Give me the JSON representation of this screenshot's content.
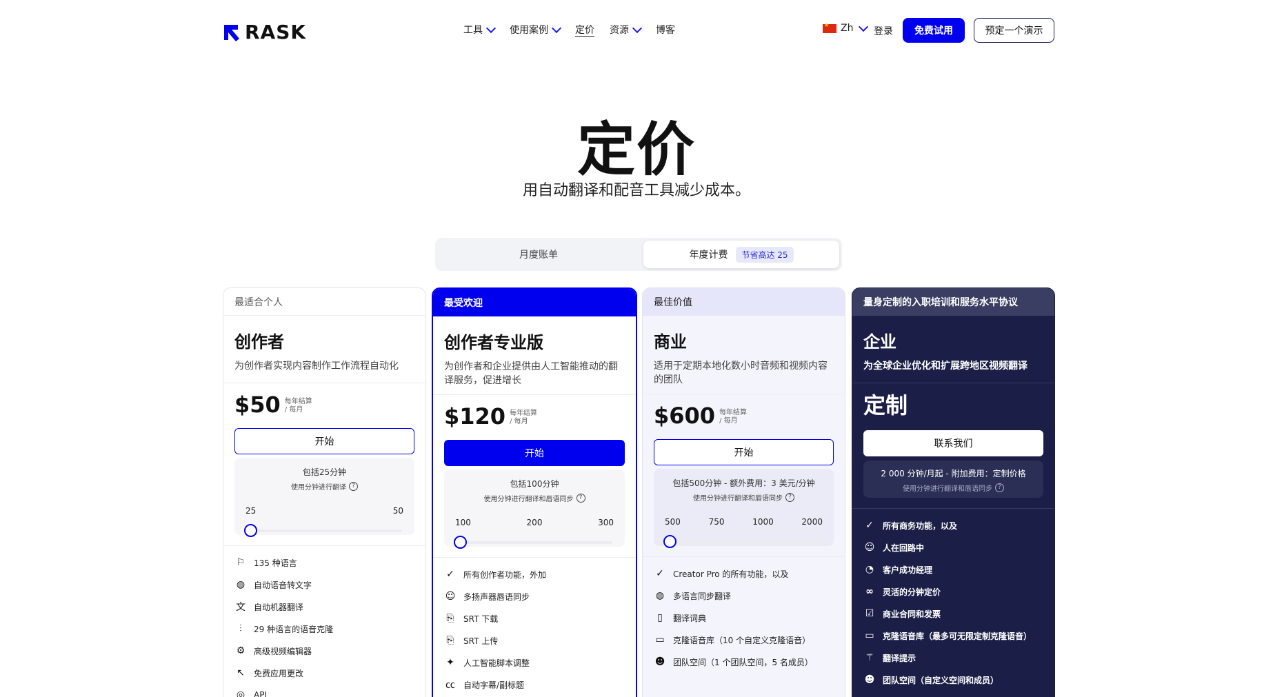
{
  "header": {
    "logo_text": "RASK",
    "nav": [
      {
        "label": "工具",
        "dropdown": true
      },
      {
        "label": "使用案例",
        "dropdown": true
      },
      {
        "label": "定价",
        "dropdown": false,
        "active": true
      },
      {
        "label": "资源",
        "dropdown": true
      },
      {
        "label": "博客",
        "dropdown": false
      }
    ],
    "lang_label": "Zh",
    "login_label": "登录",
    "trial_label": "免费试用",
    "demo_label": "预定一个演示"
  },
  "hero": {
    "title": "定价",
    "subtitle": "用自动翻译和配音工具减少成本。"
  },
  "billing": {
    "monthly_label": "月度账单",
    "yearly_label": "年度计费",
    "save_badge": "节省高达 25"
  },
  "plans": [
    {
      "tag": "最适合个人",
      "name": "创作者",
      "desc": "为创作者实现内容制作工作流程自动化",
      "price": "$50",
      "per1": "每年结算",
      "per2": "/ 每月",
      "cta": "开始",
      "usage1": "包括25分钟",
      "usage2": "使用分钟进行翻译",
      "ticks": [
        "25",
        "50"
      ],
      "slider_fraction": 0,
      "features": [
        {
          "icon": "flag-icon",
          "glyph": "⚐",
          "label": "135 种语言"
        },
        {
          "icon": "speech-to-text-icon",
          "glyph": "◍",
          "label": "自动语音转文字"
        },
        {
          "icon": "translate-icon",
          "glyph": "文",
          "label": "自动机器翻译"
        },
        {
          "icon": "voice-clone-icon",
          "glyph": "⫶",
          "label": "29 种语言的语音克隆"
        },
        {
          "icon": "editor-icon",
          "glyph": "⚙",
          "label": "高级视频编辑器"
        },
        {
          "icon": "click-icon",
          "glyph": "↖",
          "label": "免费应用更改"
        },
        {
          "icon": "api-icon",
          "glyph": "◎",
          "label": "API"
        }
      ]
    },
    {
      "tag": "最受欢迎",
      "name": "创作者专业版",
      "desc": "为创作者和企业提供由人工智能推动的翻译服务，促进增长",
      "price": "$120",
      "per1": "每年结算",
      "per2": "/ 每月",
      "cta": "开始",
      "usage1": "包括100分钟",
      "usage2": "使用分钟进行翻译和唇语同步",
      "ticks": [
        "100",
        "200",
        "300"
      ],
      "slider_fraction": 0,
      "features": [
        {
          "icon": "check-icon",
          "glyph": "✓",
          "label": "所有创作者功能，外加"
        },
        {
          "icon": "smile-icon",
          "glyph": "☺",
          "label": "多扬声器唇语同步"
        },
        {
          "icon": "srt-download-icon",
          "glyph": "⎘",
          "label": "SRT 下载"
        },
        {
          "icon": "srt-upload-icon",
          "glyph": "⎘",
          "label": "SRT 上传"
        },
        {
          "icon": "sparkle-icon",
          "glyph": "✦",
          "label": "人工智能脚本调整"
        },
        {
          "icon": "cc-icon",
          "glyph": "㏄",
          "label": "自动字幕/副标题"
        }
      ]
    },
    {
      "tag": "最佳价值",
      "name": "商业",
      "desc": "适用于定期本地化数小时音频和视频内容的团队",
      "price": "$600",
      "per1": "每年结算",
      "per2": "/ 每月",
      "cta": "开始",
      "usage1": "包括500分钟 - 额外费用：3 美元/分钟",
      "usage2": "使用分钟进行翻译和唇语同步",
      "ticks": [
        "500",
        "750",
        "1000",
        "2000"
      ],
      "slider_fraction": 0,
      "features": [
        {
          "icon": "check-icon",
          "glyph": "✓",
          "label": "Creator Pro 的所有功能，以及"
        },
        {
          "icon": "lipsync-icon",
          "glyph": "◍",
          "label": "多语言同步翻译"
        },
        {
          "icon": "book-icon",
          "glyph": "▯",
          "label": "翻译词典"
        },
        {
          "icon": "folder-icon",
          "glyph": "▭",
          "label": "克隆语音库（10 个自定义克隆语音）"
        },
        {
          "icon": "team-icon",
          "glyph": "☻",
          "label": "团队空间（1 个团队空间，5 名成员）"
        }
      ]
    },
    {
      "tag": "量身定制的入职培训和服务水平协议",
      "name": "企业",
      "desc": "为全球企业优化和扩展跨地区视频翻译",
      "price": "定制",
      "cta": "联系我们",
      "usage1": "2 000 分钟/月起 - 附加费用：定制价格",
      "usage2": "使用分钟进行翻译和唇语同步",
      "features": [
        {
          "icon": "check-icon",
          "glyph": "✓",
          "label": "所有商务功能，以及"
        },
        {
          "icon": "human-loop-icon",
          "glyph": "☺",
          "label": "人在回路中"
        },
        {
          "icon": "support-icon",
          "glyph": "◔",
          "label": "客户成功经理"
        },
        {
          "icon": "link-icon",
          "glyph": "∞",
          "label": "灵活的分钟定价"
        },
        {
          "icon": "contract-icon",
          "glyph": "☑",
          "label": "商业合同和发票"
        },
        {
          "icon": "folder-icon",
          "glyph": "▭",
          "label": "克隆语音库（最多可无限定制克隆语音）"
        },
        {
          "icon": "wand-icon",
          "glyph": "⚚",
          "label": "翻译提示"
        },
        {
          "icon": "team-icon",
          "glyph": "☻",
          "label": "团队空间（自定义空间和成员）"
        }
      ]
    }
  ],
  "colors": {
    "accent": "#0000ee",
    "enterprise_bg": "#1b1f47",
    "business_bg": "#f4f4fc"
  }
}
